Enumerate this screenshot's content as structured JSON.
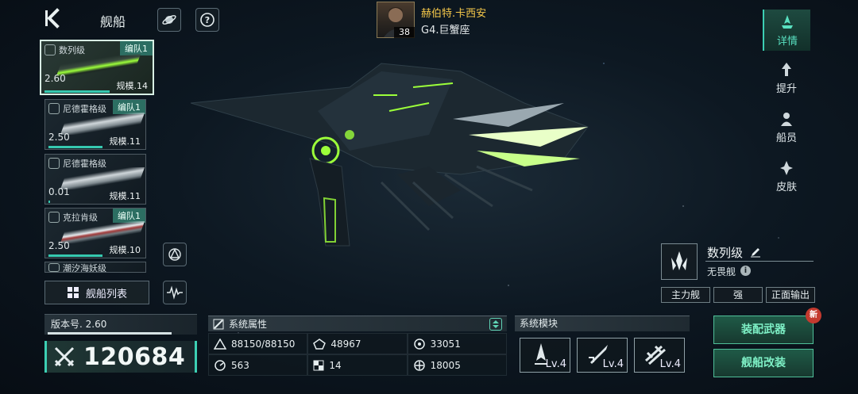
{
  "header": {
    "back_icon": "chevron-left-icon",
    "title": "舰船",
    "planet_icon": "planet-icon",
    "help_icon": "question-icon"
  },
  "player": {
    "name": "赫伯特.卡西安",
    "level": "38",
    "sector": "G4.巨蟹座"
  },
  "ship_cards": [
    {
      "class": "数列级",
      "fleet": "编队1",
      "version": "2.60",
      "scale": "规模.14",
      "progress": 0.62
    },
    {
      "class": "尼德霍格级",
      "fleet": "编队1",
      "version": "2.50",
      "scale": "规模.11",
      "progress": 0.58
    },
    {
      "class": "尼德霍格级",
      "fleet": "",
      "version": "0.01",
      "scale": "规模.11",
      "progress": 0.02
    },
    {
      "class": "克拉肯级",
      "fleet": "编队1",
      "version": "2.50",
      "scale": "规模.10",
      "progress": 0.58
    },
    {
      "class": "潮汐海妖级"
    }
  ],
  "ship_list_button": "舰船列表",
  "version": {
    "label": "版本号. 2.60",
    "progress": 0.85
  },
  "power": {
    "value": "120684"
  },
  "attributes": {
    "title": "系统属性",
    "items": [
      {
        "icon": "armor-icon",
        "value": "88150/88150"
      },
      {
        "icon": "shield-icon",
        "value": "48967"
      },
      {
        "icon": "energy-icon",
        "value": "33051"
      },
      {
        "icon": "speed-icon",
        "value": "563"
      },
      {
        "icon": "grid-icon",
        "value": "14"
      },
      {
        "icon": "target-icon",
        "value": "18005"
      }
    ]
  },
  "modules": {
    "title": "系统模块",
    "slots": [
      {
        "icon": "ship-module-icon",
        "level": "Lv.4"
      },
      {
        "icon": "missile-icon",
        "level": "Lv.4"
      },
      {
        "icon": "drone-icon",
        "level": "Lv.4"
      }
    ]
  },
  "ship_info": {
    "name": "数列级",
    "type": "无畏舰",
    "info": "i",
    "tags": [
      "主力舰",
      "强",
      "正面输出"
    ]
  },
  "actions": {
    "equip_weapon": "装配武器",
    "modify_ship": "舰船改装",
    "new_badge": "新"
  },
  "right_nav": [
    {
      "label": "详情",
      "active": true
    },
    {
      "label": "提升",
      "active": false
    },
    {
      "label": "船员",
      "active": false
    },
    {
      "label": "皮肤",
      "active": false
    }
  ],
  "colors": {
    "accent": "#3ccfb3",
    "gold": "#f5c84a",
    "button_text": "#7ef0c6",
    "glow": "#9cff3a"
  }
}
